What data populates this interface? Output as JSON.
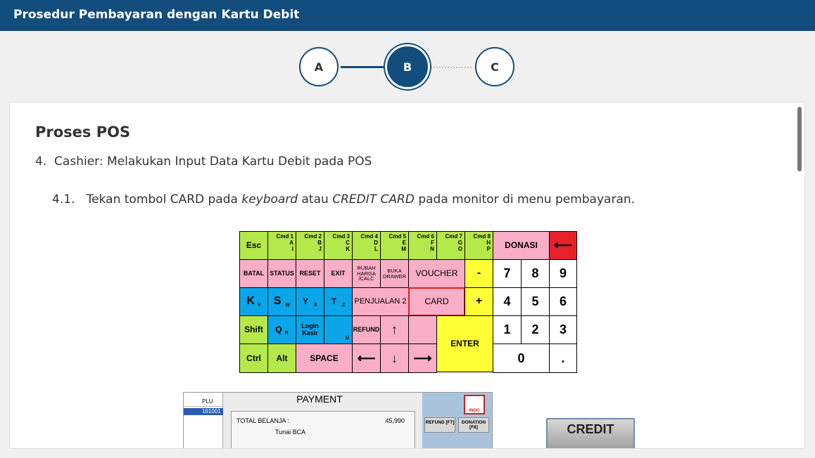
{
  "header": {
    "title": "Prosedur Pembayaran dengan Kartu Debit"
  },
  "stepper": {
    "steps": [
      "A",
      "B",
      "C"
    ],
    "active": "B"
  },
  "content": {
    "heading": "Proses POS",
    "step4_num": "4.",
    "step4_text": "Cashier: Melakukan Input Data Kartu Debit pada POS",
    "step41_num": "4.1.",
    "step41_pre": "Tekan tombol CARD pada",
    "step41_kw1": "keyboard",
    "step41_mid": "atau",
    "step41_kw2": "CREDIT CARD",
    "step41_post": "pada monitor di menu pembayaran."
  },
  "keyboard": {
    "esc": "Esc",
    "cmd1": "Cmd 1\nA\nI",
    "cmd2": "Cmd 2\nB\nJ",
    "cmd3": "Cmd 3\nC\nK",
    "cmd4": "Cmd 4\nD\nL",
    "cmd5": "Cmd 5\nE\nM",
    "cmd6": "Cmd 6\nF\nN",
    "cmd7": "Cmd 7\nG\nO",
    "cmd8": "Cmd 8\nH\nP",
    "donasi": "DONASI",
    "left_arrow": "⟵",
    "batal": "BATAL",
    "status": "STATUS",
    "reset": "RESET",
    "exit": "EXIT",
    "rubah": "RUBAH HARGA /CALC",
    "buka": "BUKA DRAWER",
    "voucher": "VOUCHER",
    "minus": "-",
    "n7": "7",
    "n8": "8",
    "n9": "9",
    "k": "K",
    "k_sub": "V",
    "s": "S",
    "s_sub": "W",
    "y": "Y",
    "y_sub": "X",
    "t": "T",
    "t_sub": "Z",
    "penjualan2": "PENJUALAN 2",
    "card": "CARD",
    "plus": "+",
    "n4": "4",
    "n5": "5",
    "n6": "6",
    "shift": "Shift",
    "q": "Q",
    "q_sub": "R",
    "login": "Login Kasir",
    "u_sub": "U",
    "refund": "REFUND",
    "up": "↑",
    "enter": "ENTER",
    "n1": "1",
    "n2": "2",
    "n3": "3",
    "ctrl": "Ctrl",
    "alt": "Alt",
    "space": "SPACE",
    "left": "⟵",
    "down": "↓",
    "right": "⟶",
    "n0": "0",
    "dot": "."
  },
  "payment_screen": {
    "plu_header": "PLU",
    "plu_row": "161001",
    "title": "PAYMENT",
    "total_label": "TOTAL BELANJA :",
    "total_value": "45,990",
    "tunai": "Tunai BCA",
    "logo": "INDO",
    "refund_btn": "REFUND [F7]",
    "donation_btn": "DONATION [F8]"
  },
  "credit_button": {
    "label": "CREDIT"
  },
  "colors": {
    "header_bg": "#134d7e",
    "accent": "#134d7e"
  }
}
